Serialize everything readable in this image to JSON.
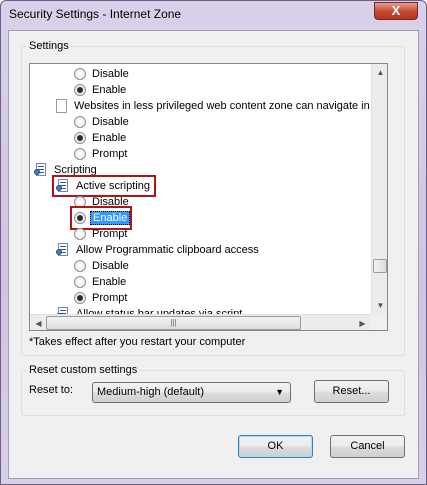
{
  "window": {
    "title": "Security Settings - Internet Zone",
    "close_label": "X"
  },
  "settings": {
    "group_label": "Settings",
    "items": [
      {
        "kind": "radio",
        "label": "Disable",
        "checked": false
      },
      {
        "kind": "radio",
        "label": "Enable",
        "checked": true
      },
      {
        "kind": "setting",
        "label": "Websites in less privileged web content zone can navigate in"
      },
      {
        "kind": "radio",
        "label": "Disable",
        "checked": false
      },
      {
        "kind": "radio",
        "label": "Enable",
        "checked": true
      },
      {
        "kind": "radio",
        "label": "Prompt",
        "checked": false
      },
      {
        "kind": "category",
        "label": "Scripting"
      },
      {
        "kind": "setting",
        "label": "Active scripting"
      },
      {
        "kind": "radio",
        "label": "Disable",
        "checked": false
      },
      {
        "kind": "radio",
        "label": "Enable",
        "checked": true
      },
      {
        "kind": "radio",
        "label": "Prompt",
        "checked": false
      },
      {
        "kind": "setting",
        "label": "Allow Programmatic clipboard access"
      },
      {
        "kind": "radio",
        "label": "Disable",
        "checked": false
      },
      {
        "kind": "radio",
        "label": "Enable",
        "checked": false
      },
      {
        "kind": "radio",
        "label": "Prompt",
        "checked": true
      },
      {
        "kind": "setting",
        "label": "Allow status bar updates via script"
      }
    ],
    "restart_note": "*Takes effect after you restart your computer"
  },
  "reset": {
    "group_label": "Reset custom settings",
    "reset_to_label": "Reset to:",
    "selected_level": "Medium-high (default)",
    "reset_button": "Reset..."
  },
  "footer": {
    "ok_label": "OK",
    "cancel_label": "Cancel"
  },
  "colors": {
    "selection": "#3399ff",
    "highlight_box": "#b0141a"
  }
}
